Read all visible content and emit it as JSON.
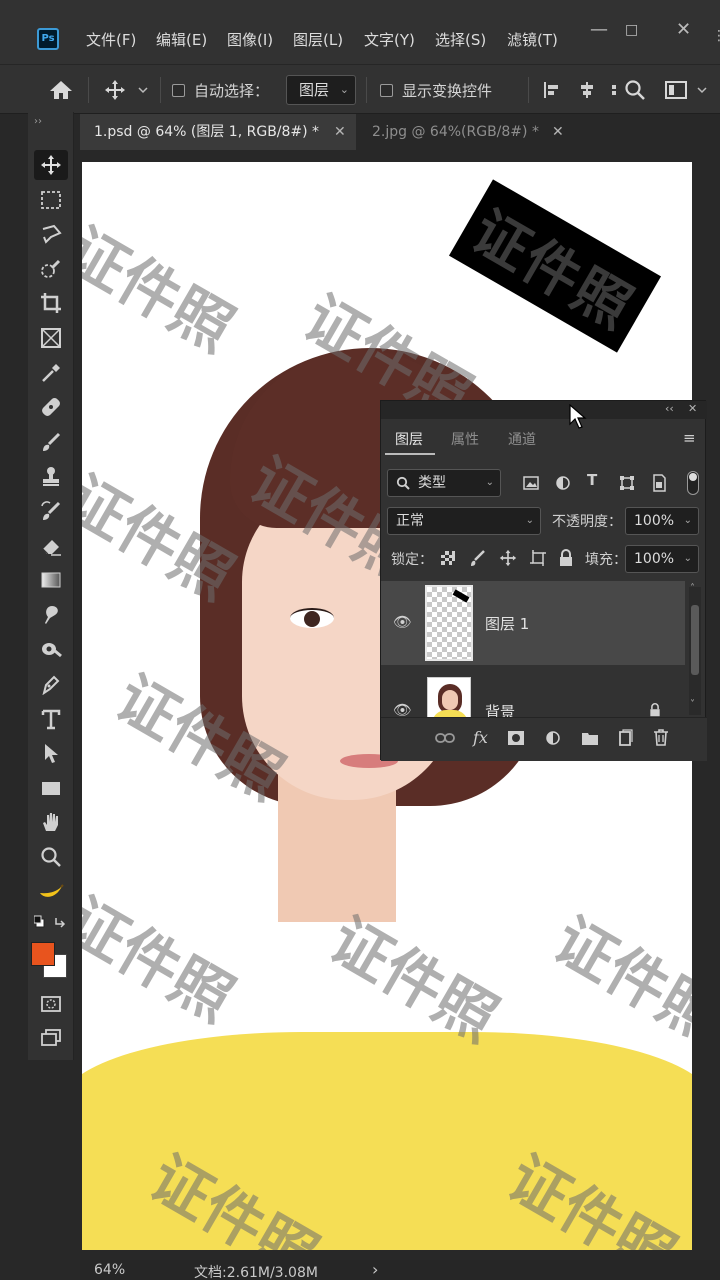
{
  "app": {
    "logo": "Ps"
  },
  "menubar": {
    "items": [
      "文件(F)",
      "编辑(E)",
      "图像(I)",
      "图层(L)",
      "文字(Y)",
      "选择(S)",
      "滤镜(T)"
    ],
    "window_controls": [
      "minimize-icon",
      "restore-icon",
      "close-icon"
    ]
  },
  "options": {
    "auto_select_label": "自动选择：",
    "auto_select_checked": false,
    "auto_select_target": "图层",
    "show_transform_label": "显示变换控件",
    "show_transform_checked": false
  },
  "tabs": [
    {
      "label": "1.psd @ 64% (图层 1, RGB/8#) *",
      "active": true
    },
    {
      "label": "2.jpg @ 64%(RGB/8#) *",
      "active": false
    }
  ],
  "toolbar": {
    "tools": [
      "move-icon",
      "marquee-icon",
      "lasso-icon",
      "quick-select-icon",
      "crop-icon",
      "frame-icon",
      "eyedropper-icon",
      "healing-icon",
      "brush-icon",
      "stamp-icon",
      "history-brush-icon",
      "eraser-icon",
      "gradient-icon",
      "blur-icon",
      "dodge-icon",
      "pen-icon",
      "type-icon",
      "path-select-icon",
      "rectangle-icon",
      "hand-icon",
      "zoom-icon",
      "banana-icon"
    ],
    "selected_tool": "move-icon",
    "foreground_color": "#e8541e",
    "background_color": "#ffffff"
  },
  "canvas": {
    "watermark_text": "证件照",
    "stamp_text": "证件照",
    "shirt_color": "#f5de55",
    "hair_color": "#5a2d26"
  },
  "status": {
    "zoom": "64%",
    "doc_info": "文档:2.61M/3.08M",
    "arrow": "›"
  },
  "layers_panel": {
    "tabs": [
      "图层",
      "属性",
      "通道"
    ],
    "active_tab": "图层",
    "filter_label": "类型",
    "blend_mode": "正常",
    "opacity_label": "不透明度：",
    "opacity_value": "100%",
    "lock_label": "锁定：",
    "fill_label": "填充：",
    "fill_value": "100%",
    "layers": [
      {
        "name": "图层 1",
        "visible": true,
        "selected": true,
        "locked": false
      },
      {
        "name": "背景",
        "visible": true,
        "selected": false,
        "locked": true
      }
    ],
    "footer_icons": [
      "link-icon",
      "fx-icon",
      "mask-icon",
      "adjustment-icon",
      "group-icon",
      "new-layer-icon",
      "delete-icon"
    ]
  }
}
